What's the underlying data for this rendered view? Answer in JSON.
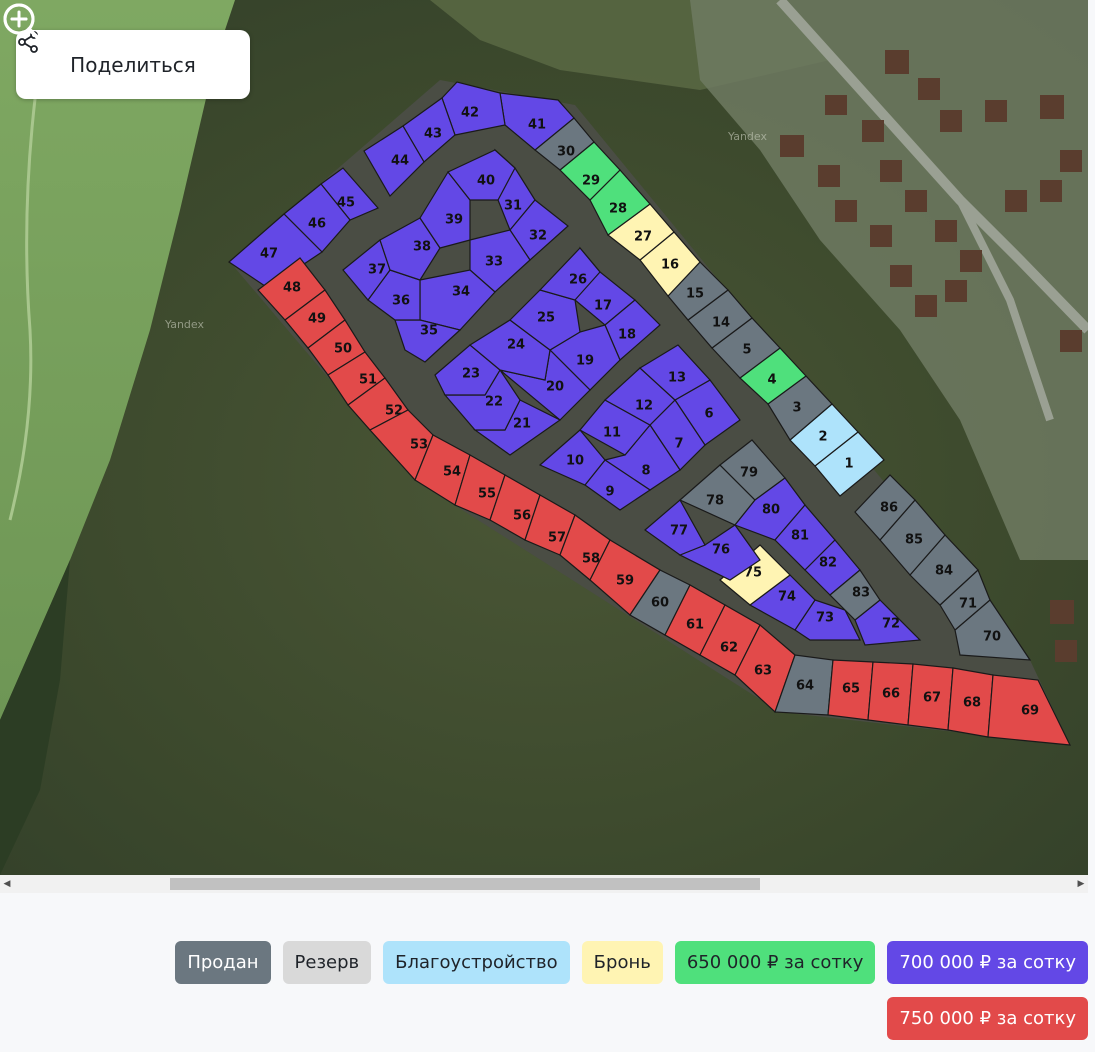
{
  "share": {
    "label": "Поделиться",
    "icon": "share-icon"
  },
  "zoom": {
    "in_icon": "zoom-in-icon",
    "out_icon": "zoom-out-icon"
  },
  "watermark": "Yandex",
  "status_colors": {
    "sold": "#6b7780",
    "reserve": "#d9d9d9",
    "improvement": "#aee3fb",
    "booking": "#fff4b3",
    "p650": "#4fe07c",
    "p700": "#6348e6",
    "p750": "#e24a4a"
  },
  "legend": [
    {
      "status": "sold",
      "label": "Продан",
      "bg": "#6b7780",
      "fg": "#ffffff"
    },
    {
      "status": "reserve",
      "label": "Резерв",
      "bg": "#d9d9d9",
      "fg": "#1f2329"
    },
    {
      "status": "improvement",
      "label": "Благоустройство",
      "bg": "#aee3fb",
      "fg": "#1f2329"
    },
    {
      "status": "booking",
      "label": "Бронь",
      "bg": "#fff4b3",
      "fg": "#1f2329"
    },
    {
      "status": "p650",
      "label": "650 000 ₽ за сотку",
      "bg": "#4fe07c",
      "fg": "#1f2329"
    },
    {
      "status": "p700",
      "label": "700 000 ₽ за сотку",
      "bg": "#6348e6",
      "fg": "#ffffff"
    },
    {
      "status": "p750",
      "label": "750 000 ₽ за сотку",
      "bg": "#e24a4a",
      "fg": "#ffffff"
    }
  ],
  "plots": [
    {
      "n": "1",
      "status": "improvement"
    },
    {
      "n": "2",
      "status": "improvement"
    },
    {
      "n": "3",
      "status": "sold"
    },
    {
      "n": "4",
      "status": "p650"
    },
    {
      "n": "5",
      "status": "sold"
    },
    {
      "n": "6",
      "status": "p700"
    },
    {
      "n": "7",
      "status": "p700"
    },
    {
      "n": "8",
      "status": "p700"
    },
    {
      "n": "9",
      "status": "p700"
    },
    {
      "n": "10",
      "status": "p700"
    },
    {
      "n": "11",
      "status": "p700"
    },
    {
      "n": "12",
      "status": "p700"
    },
    {
      "n": "13",
      "status": "p700"
    },
    {
      "n": "14",
      "status": "sold"
    },
    {
      "n": "15",
      "status": "sold"
    },
    {
      "n": "16",
      "status": "booking"
    },
    {
      "n": "17",
      "status": "p700"
    },
    {
      "n": "18",
      "status": "p700"
    },
    {
      "n": "19",
      "status": "p700"
    },
    {
      "n": "20",
      "status": "p700"
    },
    {
      "n": "21",
      "status": "p700"
    },
    {
      "n": "22",
      "status": "p700"
    },
    {
      "n": "23",
      "status": "p700"
    },
    {
      "n": "24",
      "status": "p700"
    },
    {
      "n": "25",
      "status": "p700"
    },
    {
      "n": "26",
      "status": "p700"
    },
    {
      "n": "27",
      "status": "booking"
    },
    {
      "n": "28",
      "status": "p650"
    },
    {
      "n": "29",
      "status": "p650"
    },
    {
      "n": "30",
      "status": "sold"
    },
    {
      "n": "31",
      "status": "p700"
    },
    {
      "n": "32",
      "status": "p700"
    },
    {
      "n": "33",
      "status": "p700"
    },
    {
      "n": "34",
      "status": "p700"
    },
    {
      "n": "35",
      "status": "p700"
    },
    {
      "n": "36",
      "status": "p700"
    },
    {
      "n": "37",
      "status": "p700"
    },
    {
      "n": "38",
      "status": "p700"
    },
    {
      "n": "39",
      "status": "p700"
    },
    {
      "n": "40",
      "status": "p700"
    },
    {
      "n": "41",
      "status": "p700"
    },
    {
      "n": "42",
      "status": "p700"
    },
    {
      "n": "43",
      "status": "p700"
    },
    {
      "n": "44",
      "status": "p700"
    },
    {
      "n": "45",
      "status": "p700"
    },
    {
      "n": "46",
      "status": "p700"
    },
    {
      "n": "47",
      "status": "p700"
    },
    {
      "n": "48",
      "status": "p750"
    },
    {
      "n": "49",
      "status": "p750"
    },
    {
      "n": "50",
      "status": "p750"
    },
    {
      "n": "51",
      "status": "p750"
    },
    {
      "n": "52",
      "status": "p750"
    },
    {
      "n": "53",
      "status": "p750"
    },
    {
      "n": "54",
      "status": "p750"
    },
    {
      "n": "55",
      "status": "p750"
    },
    {
      "n": "56",
      "status": "p750"
    },
    {
      "n": "57",
      "status": "p750"
    },
    {
      "n": "58",
      "status": "p750"
    },
    {
      "n": "59",
      "status": "p750"
    },
    {
      "n": "60",
      "status": "sold"
    },
    {
      "n": "61",
      "status": "p750"
    },
    {
      "n": "62",
      "status": "p750"
    },
    {
      "n": "63",
      "status": "p750"
    },
    {
      "n": "64",
      "status": "sold"
    },
    {
      "n": "65",
      "status": "p750"
    },
    {
      "n": "66",
      "status": "p750"
    },
    {
      "n": "67",
      "status": "p750"
    },
    {
      "n": "68",
      "status": "p750"
    },
    {
      "n": "69",
      "status": "p750"
    },
    {
      "n": "70",
      "status": "sold"
    },
    {
      "n": "71",
      "status": "sold"
    },
    {
      "n": "72",
      "status": "p700"
    },
    {
      "n": "73",
      "status": "p700"
    },
    {
      "n": "74",
      "status": "p700"
    },
    {
      "n": "75",
      "status": "booking"
    },
    {
      "n": "76",
      "status": "p700"
    },
    {
      "n": "77",
      "status": "p700"
    },
    {
      "n": "78",
      "status": "sold"
    },
    {
      "n": "79",
      "status": "sold"
    },
    {
      "n": "80",
      "status": "p700"
    },
    {
      "n": "81",
      "status": "p700"
    },
    {
      "n": "82",
      "status": "p700"
    },
    {
      "n": "83",
      "status": "sold"
    },
    {
      "n": "84",
      "status": "sold"
    },
    {
      "n": "85",
      "status": "sold"
    },
    {
      "n": "86",
      "status": "sold"
    }
  ]
}
